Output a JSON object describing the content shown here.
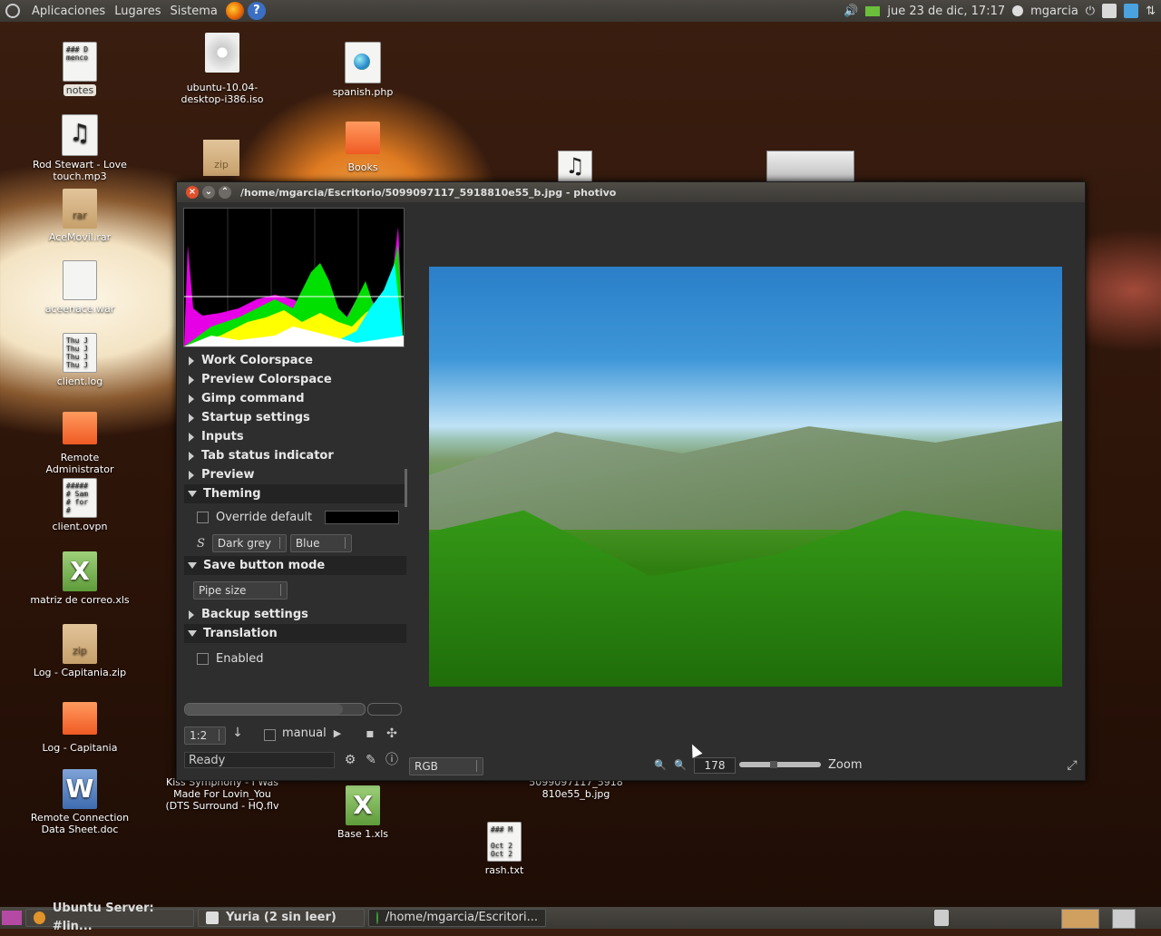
{
  "top_panel": {
    "menus": [
      "Aplicaciones",
      "Lugares",
      "Sistema"
    ],
    "clock": "jue 23 de dic, 17:17",
    "user": "mgarcia"
  },
  "desktop_icons": [
    {
      "label": "notes",
      "kind": "doc",
      "preview": "### D\nmenco"
    },
    {
      "label": "Rod Stewart - Love touch.mp3",
      "kind": "music",
      "preview": "mp3"
    },
    {
      "label": "AceMovil.rar",
      "kind": "box",
      "preview": "rar"
    },
    {
      "label": "aceenace.war",
      "kind": "doc",
      "preview": ""
    },
    {
      "label": "client.log",
      "kind": "doc",
      "preview": "Thu J\nThu J\nThu J\nThu J"
    },
    {
      "label": "Remote Administrator",
      "kind": "folder",
      "preview": ""
    },
    {
      "label": "client.ovpn",
      "kind": "doc",
      "preview": "#####\n# Sam\n# for\n#"
    },
    {
      "label": "matriz de correo.xls",
      "kind": "xls",
      "preview": "X"
    },
    {
      "label": "Log - Capitania.zip",
      "kind": "box",
      "preview": "zip"
    },
    {
      "label": "Log - Capitania",
      "kind": "folder",
      "preview": ""
    },
    {
      "label": "Remote Connection Data Sheet.doc",
      "kind": "word",
      "preview": "W"
    },
    {
      "label": "ubuntu-10.04-desktop-i386.iso",
      "kind": "cd",
      "preview": ""
    },
    {
      "label": "spanish.php",
      "kind": "globe",
      "preview": ""
    },
    {
      "label": "Books",
      "kind": "folder",
      "preview": ""
    },
    {
      "label": "Kiss Symphony - I Was Made For Lovin_You (DTS Surround - HQ.flv",
      "kind": "none",
      "preview": ""
    },
    {
      "label": "Base 1.xls",
      "kind": "xls",
      "preview": "X"
    },
    {
      "label": "5099097117_5918810e55_b.jpg",
      "kind": "none",
      "preview": ""
    },
    {
      "label": "rash.txt",
      "kind": "doc",
      "preview": "### M\n\nOct 2\nOct 2"
    }
  ],
  "window": {
    "title": "/home/mgarcia/Escritorio/5099097117_5918810e55_b.jpg - photivo",
    "sections_top": [
      "Work Colorspace",
      "Preview Colorspace",
      "Gimp command",
      "Startup settings",
      "Inputs",
      "Tab status indicator",
      "Preview"
    ],
    "theming": {
      "header": "Theming",
      "override_label": "Override default",
      "theme": "Dark grey",
      "highlight": "Blue"
    },
    "save_button": {
      "header": "Save button mode",
      "mode": "Pipe size"
    },
    "backup_header": "Backup settings",
    "translation": {
      "header": "Translation",
      "enabled_label": "Enabled"
    },
    "bottom": {
      "pipe_size": "1:2",
      "manual_label": "manual",
      "status": "Ready",
      "color_mode": "RGB",
      "zoom_value": "178",
      "zoom_label": "Zoom",
      "zoom_fraction": 0.42
    }
  },
  "taskbar": {
    "tasks": [
      "Ubuntu Server: #lin...",
      "Yuria (2 sin leer)",
      "/home/mgarcia/Escritori..."
    ]
  }
}
